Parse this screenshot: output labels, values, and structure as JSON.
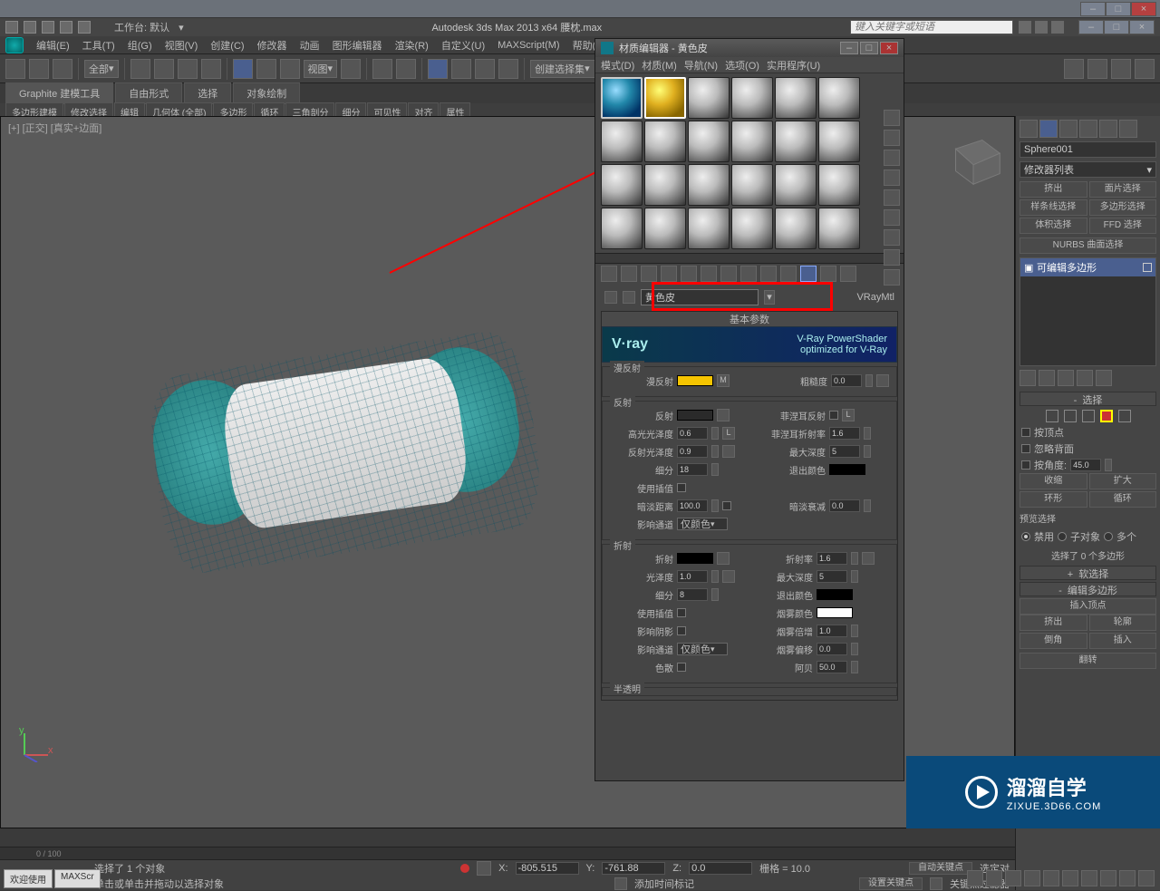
{
  "app": {
    "title_full": "Autodesk 3ds Max  2013 x64   腰枕.max",
    "workspace_label": "工作台: 默认",
    "search_placeholder": "键入关键字或短语"
  },
  "menus": {
    "items": [
      "编辑(E)",
      "工具(T)",
      "组(G)",
      "视图(V)",
      "创建(C)",
      "修改器",
      "动画",
      "图形编辑器",
      "渲染(R)",
      "自定义(U)",
      "MAXScript(M)",
      "帮助(H)"
    ]
  },
  "toolbar": {
    "dropdown_all": "全部",
    "dropdown_view": "视图",
    "dropdown_selset": "创建选择集"
  },
  "ribbon": {
    "tabs": [
      "Graphite 建模工具",
      "自由形式",
      "选择",
      "对象绘制"
    ],
    "subtabs": [
      "多边形建模",
      "修改选择",
      "编辑",
      "几何体 (全部)",
      "多边形",
      "循环",
      "三角剖分",
      "细分",
      "可见性",
      "对齐",
      "属性"
    ]
  },
  "viewport": {
    "label": "[+] [正交] [真实+边面]"
  },
  "material_editor": {
    "title": "材质编辑器 - 黄色皮",
    "menus": [
      "模式(D)",
      "材质(M)",
      "导航(N)",
      "选项(O)",
      "实用程序(U)"
    ],
    "name_value": "黄色皮",
    "type_label": "VRayMtl",
    "rollout_basic": "基本参数",
    "vray_logo": "V·ray",
    "vray_title": "V-Ray PowerShader",
    "vray_sub": "optimized for V-Ray",
    "groups": {
      "diffuse": {
        "title": "漫反射",
        "label_diffuse": "漫反射",
        "btn_m": "M",
        "label_rough": "粗糙度",
        "val_rough": "0.0"
      },
      "reflect": {
        "title": "反射",
        "label_reflect": "反射",
        "label_hilight": "高光光泽度",
        "val_hilight": "0.6",
        "btn_l1": "L",
        "label_refl_gloss": "反射光泽度",
        "val_refl_gloss": "0.9",
        "label_subdiv": "细分",
        "val_subdiv": "18",
        "label_interp": "使用插值",
        "label_dimdist": "暗淡距离",
        "val_dimdist": "100.0",
        "label_affect": "影响通道",
        "dd_affect": "仅颜色",
        "label_fresnel": "菲涅耳反射",
        "label_fresnel_ior": "菲涅耳折射率",
        "val_fresnel_ior": "1.6",
        "btn_l2": "L",
        "label_maxdepth": "最大深度",
        "val_maxdepth": "5",
        "label_exitcolor": "退出颜色",
        "label_dimfall": "暗淡衰减",
        "val_dimfall": "0.0"
      },
      "refract": {
        "title": "折射",
        "label_refract": "折射",
        "label_gloss": "光泽度",
        "val_gloss": "1.0",
        "label_subdiv": "细分",
        "val_subdiv": "8",
        "label_interp": "使用插值",
        "label_shadow": "影响阴影",
        "label_affect": "影响通道",
        "dd_affect": "仅颜色",
        "label_dispersion": "色散",
        "label_ior": "折射率",
        "val_ior": "1.6",
        "label_maxdepth": "最大深度",
        "val_maxdepth": "5",
        "label_exitcolor": "退出颜色",
        "label_fogcolor": "烟雾颜色",
        "label_fogmult": "烟雾倍增",
        "val_fogmult": "1.0",
        "label_fogbias": "烟雾偏移",
        "val_fogbias": "0.0",
        "label_abbe": "阿贝",
        "val_abbe": "50.0"
      },
      "translucency": {
        "title": "半透明"
      }
    }
  },
  "modify_panel": {
    "object_name": "Sphere001",
    "dd_modifier": "修改器列表",
    "buttons": [
      "挤出",
      "面片选择",
      "样条线选择",
      "多边形选择",
      "体积选择",
      "FFD 选择"
    ],
    "nurbs_label": "NURBS 曲面选择",
    "stack_item": "可编辑多边形",
    "selection": {
      "header": "选择",
      "by_vertex": "按顶点",
      "ignore_back": "忽略背面",
      "by_angle": "按角度:",
      "angle_val": "45.0",
      "shrink": "收缩",
      "grow": "扩大",
      "ring": "环形",
      "loop": "循环",
      "preview_label": "预览选择",
      "radio_off": "禁用",
      "radio_sub": "子对象",
      "radio_multi": "多个",
      "sel_count": "选择了 0 个多边形"
    },
    "soft_sel_hd": "软选择",
    "edit_poly_hd": "编辑多边形",
    "insert_vtx": "插入顶点",
    "btns2": [
      "挤出",
      "轮廓",
      "倒角",
      "插入"
    ],
    "flip": "翻转"
  },
  "status": {
    "time_range": "0 / 100",
    "sel_msg": "选择了 1 个对象",
    "hint_msg": "单击或单击并拖动以选择对象",
    "add_time_tag": "添加时间标记",
    "coord_x_label": "X:",
    "coord_x": "-805.515",
    "coord_y_label": "Y:",
    "coord_y": "-761.88",
    "coord_z_label": "Z:",
    "coord_z": "0.0",
    "grid_label": "栅格 = 10.0",
    "autokey": "自动关键点",
    "selected_label": "选定对",
    "setkey": "设置关键点",
    "keyfilter": "关键点过滤器",
    "tabs": [
      "欢迎使用",
      "MAXScr"
    ]
  },
  "watermark": {
    "big": "溜溜自学",
    "sm": "ZIXUE.3D66.COM"
  }
}
